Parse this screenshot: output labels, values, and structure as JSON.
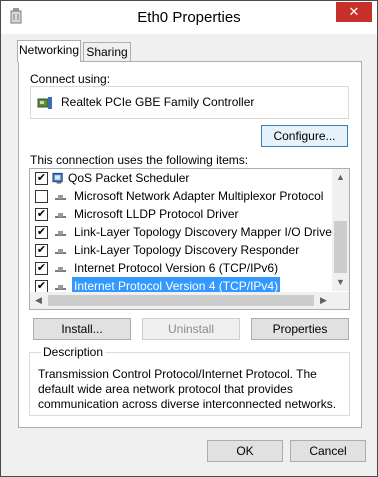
{
  "window": {
    "title": "Eth0 Properties",
    "close_glyph": "✕"
  },
  "tabs": [
    {
      "label": "Networking",
      "active": true
    },
    {
      "label": "Sharing",
      "active": false
    }
  ],
  "connect": {
    "label": "Connect using:",
    "adapter": "Realtek PCIe GBE Family Controller",
    "configure_button": "Configure..."
  },
  "items": {
    "label": "This connection uses the following items:",
    "list": [
      {
        "label": "QoS Packet Scheduler",
        "checked": true,
        "icon": "qos-icon"
      },
      {
        "label": "Microsoft Network Adapter Multiplexor Protocol",
        "checked": false,
        "icon": "protocol-icon"
      },
      {
        "label": "Microsoft LLDP Protocol Driver",
        "checked": true,
        "icon": "protocol-icon"
      },
      {
        "label": "Link-Layer Topology Discovery Mapper I/O Driver",
        "checked": true,
        "icon": "protocol-icon"
      },
      {
        "label": "Link-Layer Topology Discovery Responder",
        "checked": true,
        "icon": "protocol-icon"
      },
      {
        "label": "Internet Protocol Version 6 (TCP/IPv6)",
        "checked": true,
        "icon": "protocol-icon"
      },
      {
        "label": "Internet Protocol Version 4 (TCP/IPv4)",
        "checked": true,
        "icon": "protocol-icon",
        "selected": true
      }
    ]
  },
  "actions": {
    "install": "Install...",
    "uninstall": "Uninstall",
    "properties": "Properties"
  },
  "description": {
    "title": "Description",
    "text": "Transmission Control Protocol/Internet Protocol. The default wide area network protocol that provides communication across diverse interconnected networks."
  },
  "footer": {
    "ok": "OK",
    "cancel": "Cancel"
  },
  "colors": {
    "selection": "#3399ff",
    "close": "#c7302b",
    "focus_border": "#3c7fb1"
  }
}
